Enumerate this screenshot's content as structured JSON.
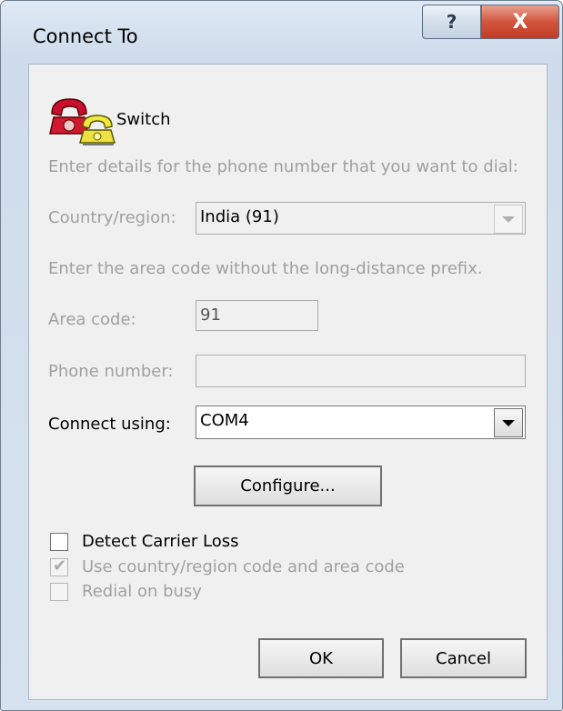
{
  "window": {
    "title": "Connect To",
    "help_glyph": "?",
    "close_glyph": "X"
  },
  "connection": {
    "name": "Switch",
    "icon": "phone-icon"
  },
  "instructions": {
    "enter_details": "Enter details for the phone number that you want to dial:",
    "area_code_hint": "Enter the area code without the long-distance prefix."
  },
  "country": {
    "label": "Country/region:",
    "value": "India (91)"
  },
  "area_code": {
    "label": "Area code:",
    "value": "91"
  },
  "phone_number": {
    "label": "Phone number:",
    "value": ""
  },
  "connect_using": {
    "label": "Connect using:",
    "value": "COM4"
  },
  "buttons": {
    "configure": "Configure...",
    "ok": "OK",
    "cancel": "Cancel"
  },
  "options": {
    "detect_carrier_loss": {
      "label": "Detect Carrier Loss",
      "checked": false,
      "enabled": true
    },
    "use_country_code": {
      "label": "Use country/region code and area code",
      "checked": true,
      "enabled": false
    },
    "redial_on_busy": {
      "label": "Redial on busy",
      "checked": false,
      "enabled": false
    }
  }
}
